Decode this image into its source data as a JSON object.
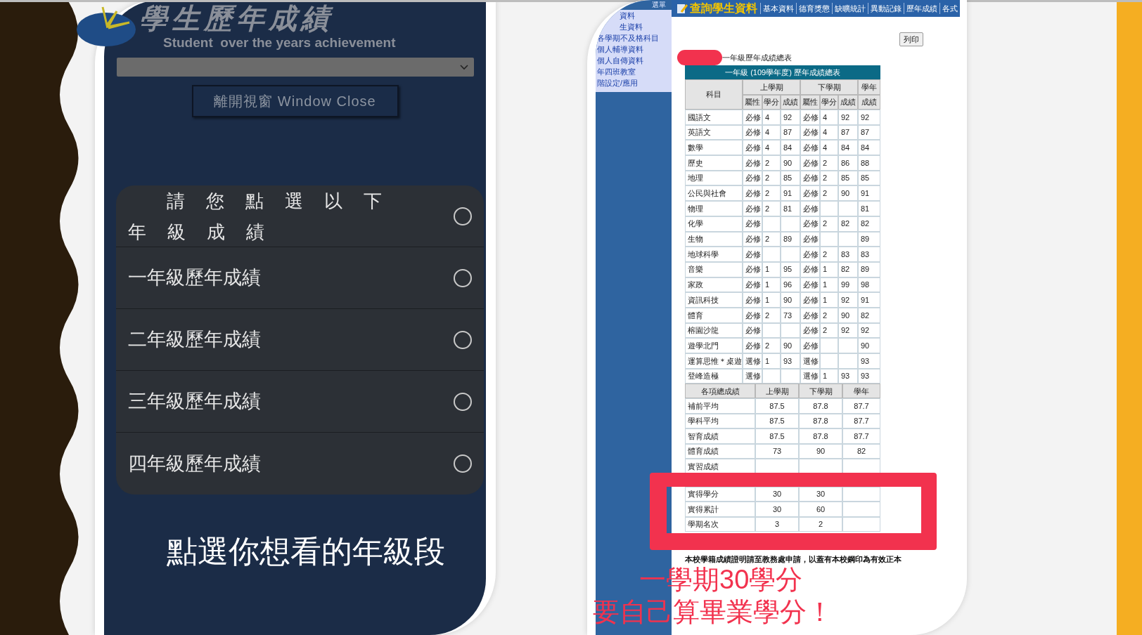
{
  "left_app": {
    "logo_title": "學生歷年成績",
    "logo_subtitle": "Student  over the years achievement",
    "close_button": "離開視窗 Window Close",
    "dialog": {
      "title": "請您點選以下年級成績",
      "title_selected": false,
      "options": [
        {
          "label": "一年級歷年成績",
          "selected": false
        },
        {
          "label": "二年級歷年成績",
          "selected": false
        },
        {
          "label": "三年級歷年成績",
          "selected": false
        },
        {
          "label": "四年級歷年成績",
          "selected": false
        }
      ]
    }
  },
  "left_caption": "點選你想看的年級段",
  "right_app": {
    "nav": {
      "title": "查詢學生資料",
      "items": [
        "基本資料",
        "德育獎懲",
        "缺曠統計",
        "異動記錄",
        "歷年成績",
        "各式"
      ]
    },
    "sidebar": {
      "header": "選單",
      "items": [
        "資料",
        "生資料",
        "各學期不及格科目",
        "個人輔導資料",
        "個人自傳資料",
        "年四班教室",
        "階設定/應用"
      ]
    },
    "print_button": "列印",
    "report_label": "一年級歷年成績總表",
    "table": {
      "title": "一年級 (109學年度) 歷年成績總表",
      "subject_header": "科目",
      "group_headers": [
        "上學期",
        "下學期",
        "學年"
      ],
      "sub_headers": [
        "屬性",
        "學分",
        "成績",
        "屬性",
        "學分",
        "成績",
        "成績"
      ],
      "rows": [
        [
          "國語文",
          "必修",
          "4",
          "92",
          "必修",
          "4",
          "92",
          "92"
        ],
        [
          "英語文",
          "必修",
          "4",
          "87",
          "必修",
          "4",
          "87",
          "87"
        ],
        [
          "數學",
          "必修",
          "4",
          "84",
          "必修",
          "4",
          "84",
          "84"
        ],
        [
          "歷史",
          "必修",
          "2",
          "90",
          "必修",
          "2",
          "86",
          "88"
        ],
        [
          "地理",
          "必修",
          "2",
          "85",
          "必修",
          "2",
          "85",
          "85"
        ],
        [
          "公民與社會",
          "必修",
          "2",
          "91",
          "必修",
          "2",
          "90",
          "91"
        ],
        [
          "物理",
          "必修",
          "2",
          "81",
          "必修",
          "",
          "",
          "81"
        ],
        [
          "化學",
          "必修",
          "",
          "",
          "必修",
          "2",
          "82",
          "82"
        ],
        [
          "生物",
          "必修",
          "2",
          "89",
          "必修",
          "",
          "",
          "89"
        ],
        [
          "地球科學",
          "必修",
          "",
          "",
          "必修",
          "2",
          "83",
          "83"
        ],
        [
          "音樂",
          "必修",
          "1",
          "95",
          "必修",
          "1",
          "82",
          "89"
        ],
        [
          "家政",
          "必修",
          "1",
          "96",
          "必修",
          "1",
          "99",
          "98"
        ],
        [
          "資訊科技",
          "必修",
          "1",
          "90",
          "必修",
          "1",
          "92",
          "91"
        ],
        [
          "體育",
          "必修",
          "2",
          "73",
          "必修",
          "2",
          "90",
          "82"
        ],
        [
          "榕園沙龍",
          "必修",
          "",
          "",
          "必修",
          "2",
          "92",
          "92"
        ],
        [
          "遊學北門",
          "必修",
          "2",
          "90",
          "必修",
          "",
          "",
          "90"
        ],
        [
          "運算思惟＊桌遊",
          "選修",
          "1",
          "93",
          "選修",
          "",
          "",
          "93"
        ],
        [
          "登峰造極",
          "選修",
          "",
          "",
          "選修",
          "1",
          "93",
          "93"
        ]
      ]
    },
    "summary": {
      "columns": [
        "各項總成績",
        "上學期",
        "下學期",
        "學年"
      ],
      "rows": [
        [
          "補前平均",
          "87.5",
          "87.8",
          "87.7"
        ],
        [
          "學科平均",
          "87.5",
          "87.8",
          "87.7"
        ],
        [
          "智育成績",
          "87.5",
          "87.8",
          "87.7"
        ],
        [
          "體育成績",
          "73",
          "90",
          "82"
        ],
        [
          "實習成績",
          "",
          "",
          ""
        ]
      ],
      "highlighted_rows": [
        [
          "實得學分",
          "30",
          "30",
          ""
        ],
        [
          "實得累計",
          "30",
          "60",
          ""
        ],
        [
          "學期名次",
          "3",
          "2",
          ""
        ]
      ]
    },
    "footnote": "本校學籍成績證明請至教務處申請，以蓋有本校鋼印為有效正本"
  },
  "annotation": [
    "一學期30學分",
    "要自己算畢業學分！"
  ]
}
